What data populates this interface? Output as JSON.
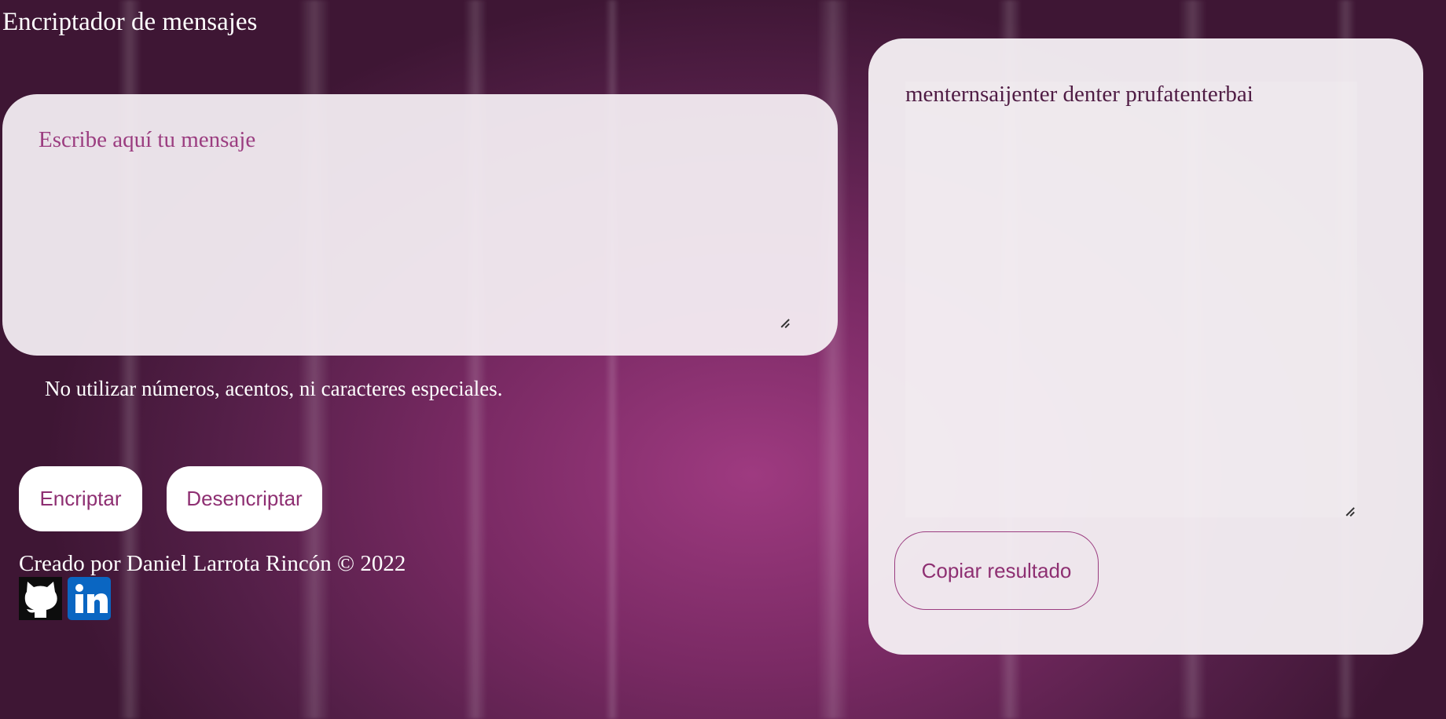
{
  "header": {
    "title": "Encriptador de mensajes"
  },
  "input": {
    "placeholder": "Escribe aquí tu mensaje",
    "value": ""
  },
  "warning": "No utilizar números, acentos, ni caracteres especiales.",
  "buttons": {
    "encrypt": "Encriptar",
    "decrypt": "Desencriptar",
    "copy": "Copiar resultado"
  },
  "footer": {
    "credit": "Creado por Daniel Larrota Rincón © 2022",
    "links": [
      {
        "icon": "github-icon"
      },
      {
        "icon": "linkedin-icon"
      }
    ]
  },
  "output": {
    "result": "menternsaijenter denter prufatenterbai"
  },
  "colors": {
    "background": "#7a2a64",
    "accent": "#8e2f72",
    "card": "#f4eef3",
    "linkedin": "#0a66c2"
  }
}
